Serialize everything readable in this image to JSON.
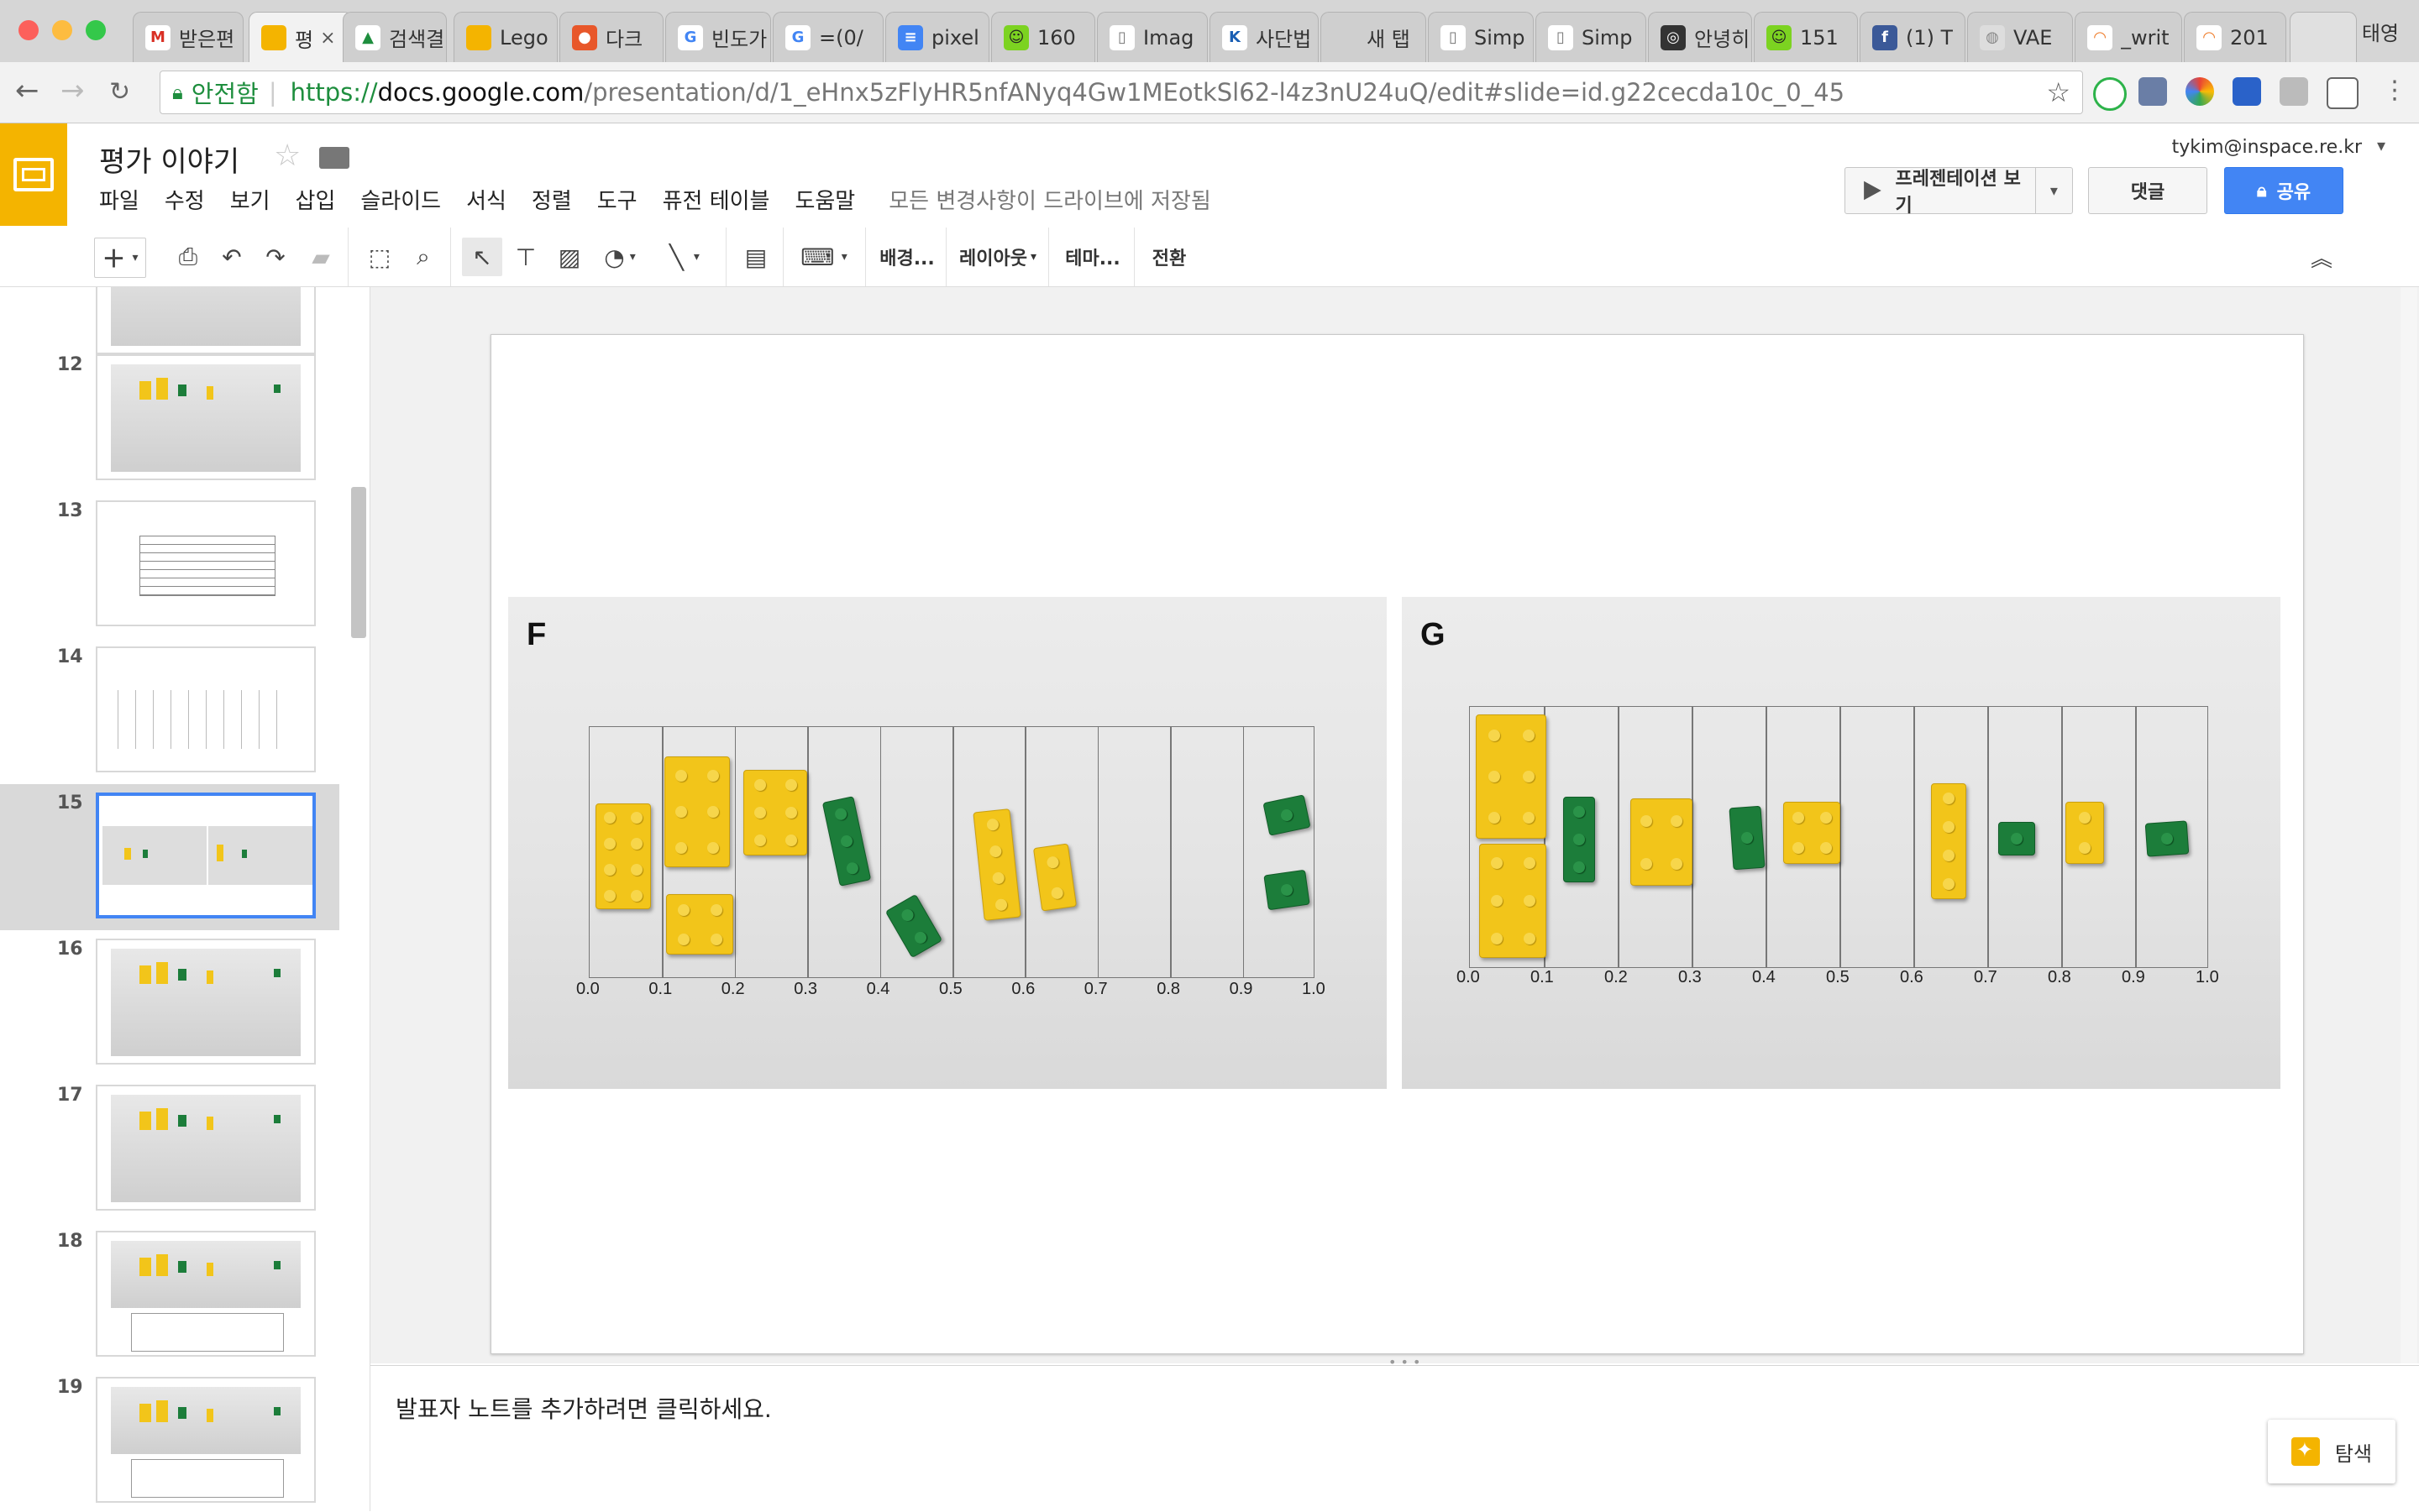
{
  "browser": {
    "profile_name": "태영",
    "tabs": [
      {
        "title": "받은편",
        "favicon": "M",
        "color": "#ffffff",
        "fg": "#d93025"
      },
      {
        "title": "평",
        "favicon": "",
        "color": "#f4b400",
        "fg": "#fff",
        "active": true
      },
      {
        "title": "검색결",
        "favicon": "▲",
        "color": "#ffffff",
        "fg": "#1e8e3e"
      },
      {
        "title": "Lego",
        "favicon": "",
        "color": "#f4b400",
        "fg": "#fff"
      },
      {
        "title": "다크",
        "favicon": "●",
        "color": "#e8572a",
        "fg": "#fff"
      },
      {
        "title": "빈도가",
        "favicon": "G",
        "color": "#ffffff",
        "fg": "#4285f4"
      },
      {
        "title": "=(0/",
        "favicon": "G",
        "color": "#ffffff",
        "fg": "#4285f4"
      },
      {
        "title": "pixel",
        "favicon": "≡",
        "color": "#4285f4",
        "fg": "#fff"
      },
      {
        "title": "160",
        "favicon": "☺",
        "color": "#7cd321",
        "fg": "#222"
      },
      {
        "title": "Imag",
        "favicon": "▯",
        "color": "#ffffff",
        "fg": "#777"
      },
      {
        "title": "사단법",
        "favicon": "K",
        "color": "#ffffff",
        "fg": "#1a5fb4"
      },
      {
        "title": "새 탭",
        "favicon": "",
        "color": "#cfcfcf",
        "fg": "#cfcfcf"
      },
      {
        "title": "Simp",
        "favicon": "▯",
        "color": "#ffffff",
        "fg": "#777"
      },
      {
        "title": "Simp",
        "favicon": "▯",
        "color": "#ffffff",
        "fg": "#777"
      },
      {
        "title": "안녕히",
        "favicon": "◎",
        "color": "#333333",
        "fg": "#fff"
      },
      {
        "title": "151",
        "favicon": "☺",
        "color": "#7cd321",
        "fg": "#222"
      },
      {
        "title": "(1) T",
        "favicon": "f",
        "color": "#3b5998",
        "fg": "#fff"
      },
      {
        "title": "VAE",
        "favicon": "◍",
        "color": "#dddddd",
        "fg": "#888"
      },
      {
        "title": "_writ",
        "favicon": "◠",
        "color": "#ffffff",
        "fg": "#ee7722"
      },
      {
        "title": "201",
        "favicon": "◠",
        "color": "#ffffff",
        "fg": "#ee7722"
      }
    ],
    "secure_label": "안전함",
    "url_proto": "https://",
    "url_host": "docs.google.com",
    "url_path": "/presentation/d/1_eHnx5zFlyHR5nfANyq4Gw1MEotkSl62-l4z3nU24uQ/edit#slide=id.g22cecda10c_0_45"
  },
  "docs": {
    "title": "평가 이야기",
    "menu": [
      "파일",
      "수정",
      "보기",
      "삽입",
      "슬라이드",
      "서식",
      "정렬",
      "도구",
      "퓨전 테이블",
      "도움말"
    ],
    "save_status": "모든 변경사항이 드라이브에 저장됨",
    "user_email": "tykim@inspace.re.kr",
    "present_label": "프레젠테이션 보기",
    "comments_label": "댓글",
    "share_label": "공유",
    "toolbar": {
      "background": "배경...",
      "layout": "레이아웃",
      "theme": "테마...",
      "transition": "전환"
    }
  },
  "filmstrip": {
    "slides": [
      {
        "num": "",
        "kind": "photo"
      },
      {
        "num": "12",
        "kind": "photo"
      },
      {
        "num": "13",
        "kind": "table"
      },
      {
        "num": "14",
        "kind": "grid"
      },
      {
        "num": "15",
        "kind": "pair",
        "selected": true
      },
      {
        "num": "16",
        "kind": "photo"
      },
      {
        "num": "17",
        "kind": "photo"
      },
      {
        "num": "18",
        "kind": "photo-table"
      },
      {
        "num": "19",
        "kind": "photo-table"
      }
    ]
  },
  "slide": {
    "panels": [
      {
        "label": "F",
        "ticks": [
          "0.0",
          "0.1",
          "0.2",
          "0.3",
          "0.4",
          "0.5",
          "0.6",
          "0.7",
          "0.8",
          "0.9",
          "1.0"
        ]
      },
      {
        "label": "G",
        "ticks": [
          "0.0",
          "0.1",
          "0.2",
          "0.3",
          "0.4",
          "0.5",
          "0.6",
          "0.7",
          "0.8",
          "0.9",
          "1.0"
        ]
      }
    ]
  },
  "notes": {
    "placeholder": "발표자 노트를 추가하려면 클릭하세요.",
    "explore_label": "탐색"
  }
}
